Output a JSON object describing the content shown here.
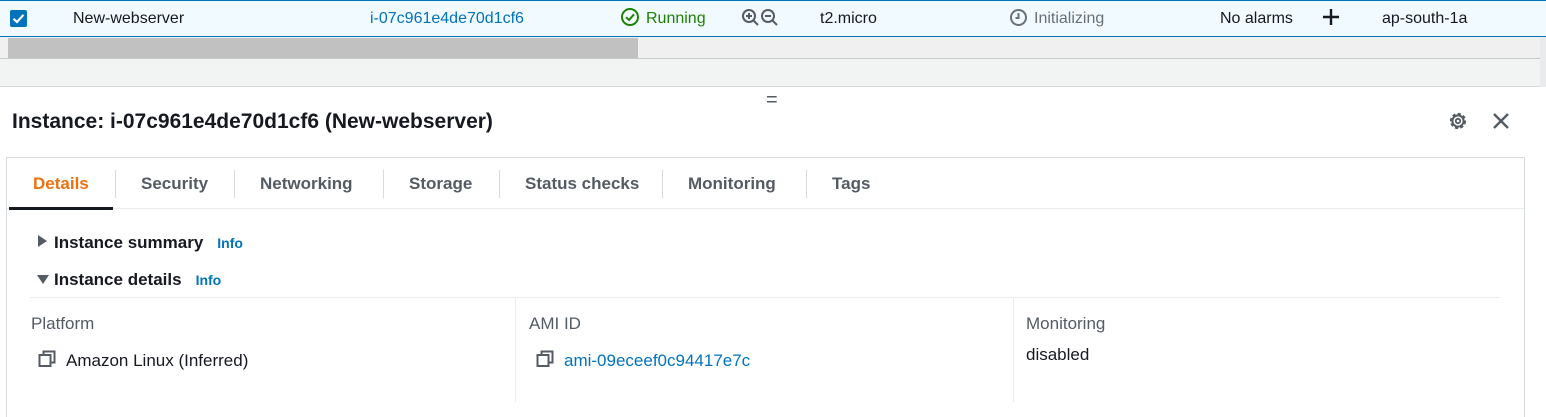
{
  "instance_row": {
    "checked": true,
    "name": "New-webserver",
    "instance_id": "i-07c961e4de70d1cf6",
    "state": "Running",
    "instance_type": "t2.micro",
    "status_check": "Initializing",
    "alarm_status": "No alarms",
    "availability_zone": "ap-south-1a"
  },
  "panel": {
    "title": "Instance: i-07c961e4de70d1cf6 (New-webserver)",
    "drag_handle": "="
  },
  "tabs": [
    {
      "label": "Details",
      "active": true
    },
    {
      "label": "Security"
    },
    {
      "label": "Networking"
    },
    {
      "label": "Storage"
    },
    {
      "label": "Status checks"
    },
    {
      "label": "Monitoring"
    },
    {
      "label": "Tags"
    }
  ],
  "sections": {
    "summary": {
      "title": "Instance summary",
      "info": "Info",
      "expanded": false
    },
    "details": {
      "title": "Instance details",
      "info": "Info",
      "expanded": true
    }
  },
  "fields": {
    "platform": {
      "label": "Platform",
      "value": "Amazon Linux (Inferred)"
    },
    "ami_id": {
      "label": "AMI ID",
      "value": "ami-09eceef0c94417e7c"
    },
    "monitoring": {
      "label": "Monitoring",
      "value": "disabled"
    }
  },
  "colors": {
    "link": "#0073bb",
    "running": "#1d8102",
    "active_tab": "#ec7211",
    "row_highlight": "#f1faff"
  }
}
